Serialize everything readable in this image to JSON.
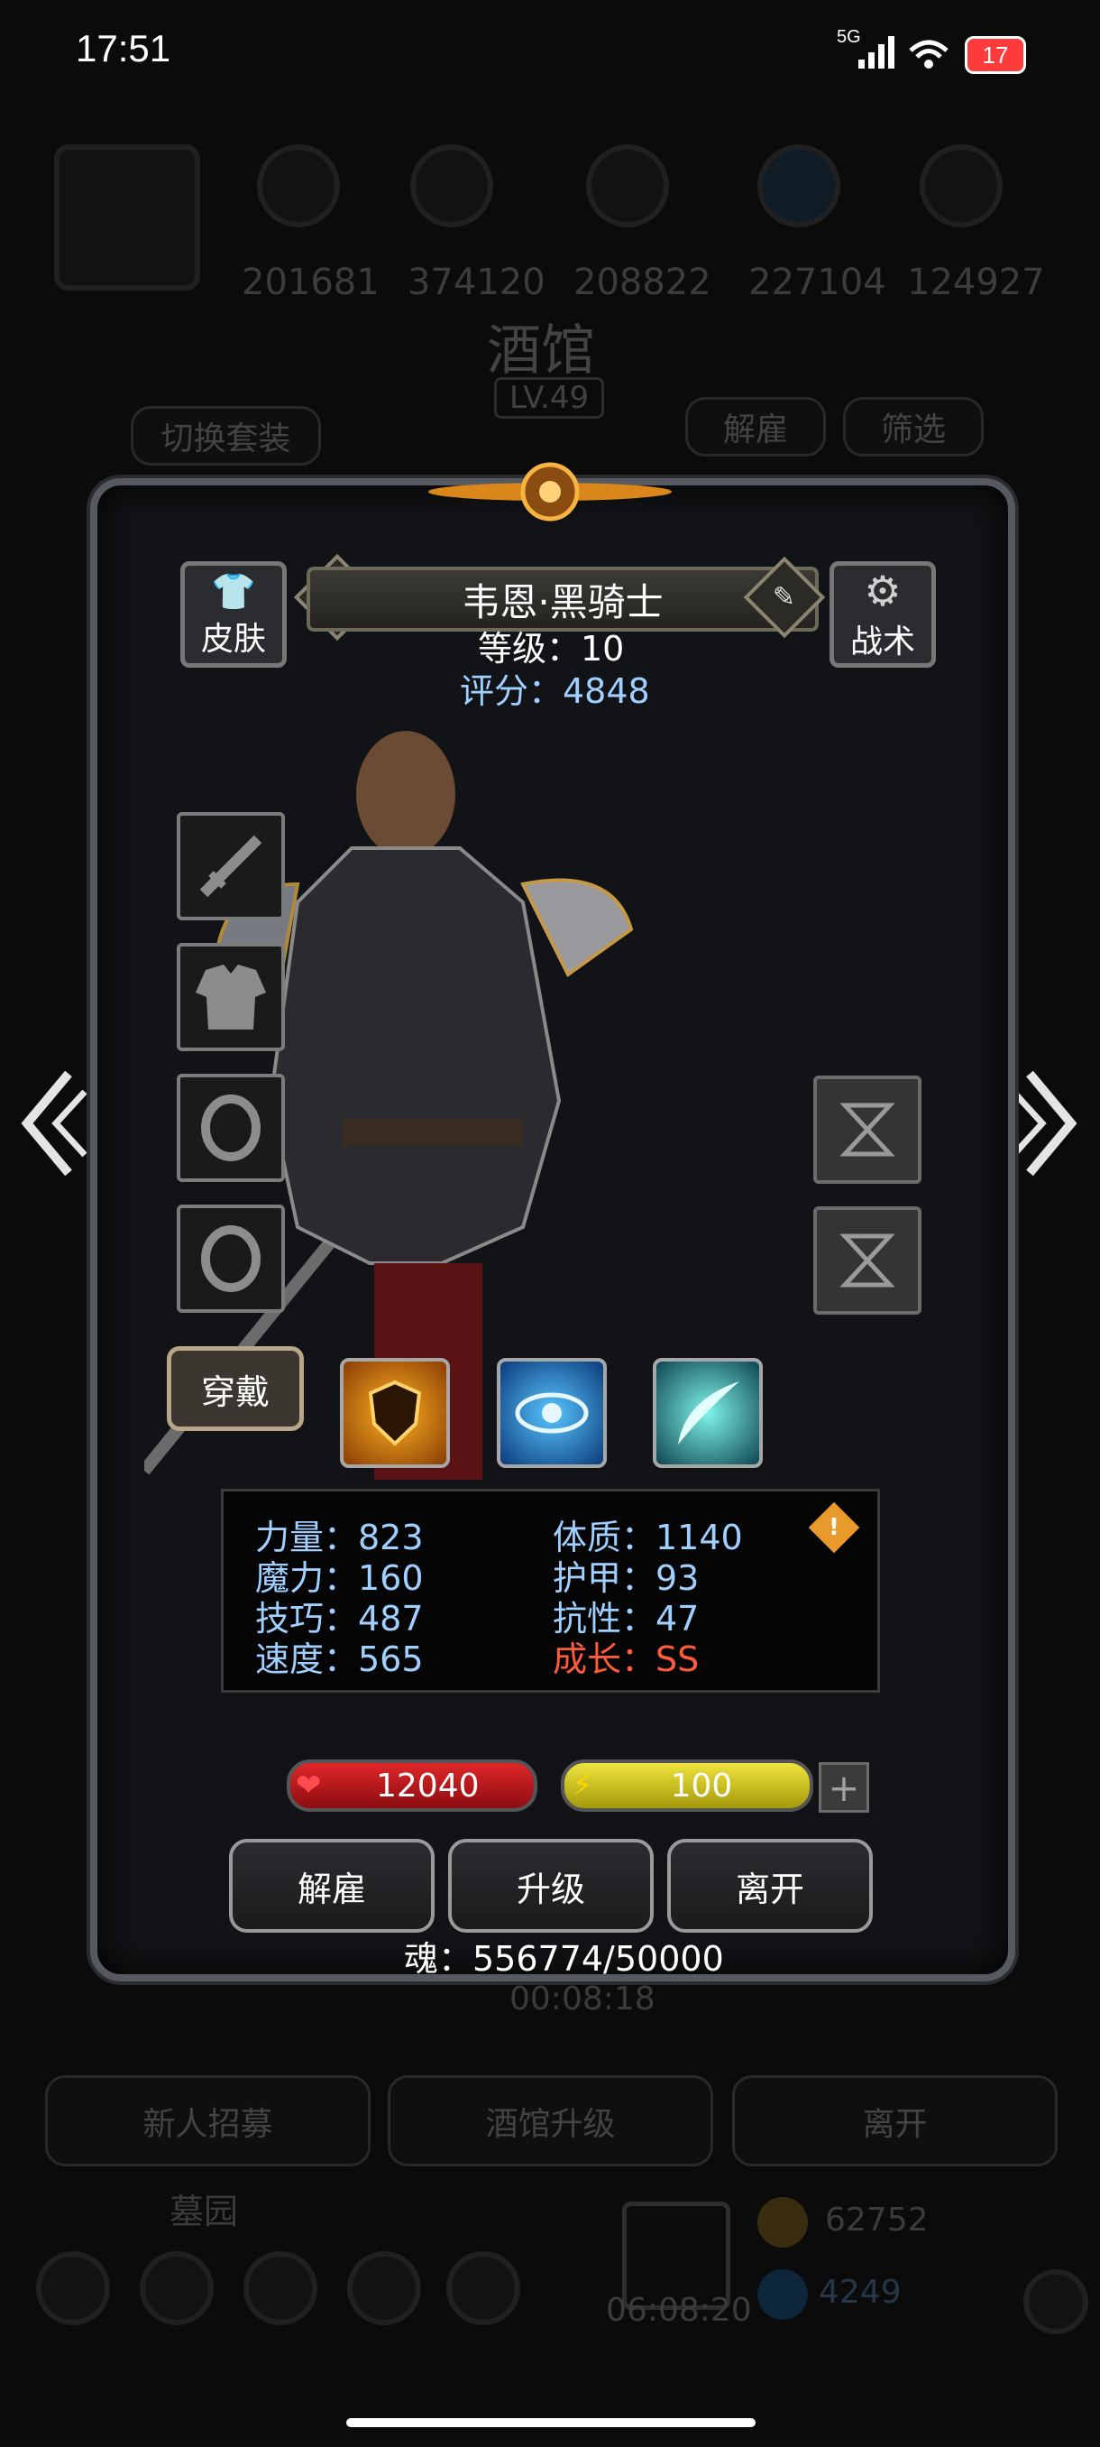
{
  "status_bar": {
    "time": "17:51",
    "network": "5G",
    "battery": "17"
  },
  "background": {
    "numbers": [
      "201681",
      "374120",
      "208822",
      "227104",
      "124927"
    ],
    "title": "酒馆",
    "level": "LV.49",
    "switch_outfit": "切换套装",
    "dismiss": "解雇",
    "filter": "筛选",
    "timer": "00:08:18",
    "bottom_buttons": [
      "新人招募",
      "酒馆升级",
      "离开"
    ],
    "mercenary_label": "墓园",
    "bottom_timer": "06:08:20",
    "currency_1": "62752",
    "currency_2": "4249"
  },
  "hero": {
    "skin_label": "皮肤",
    "tactics_label": "战术",
    "name": "韦恩·黑骑士",
    "level_text": "等级：10",
    "score_text": "评分：4848",
    "equip_label": "穿戴"
  },
  "stats": {
    "left": [
      "力量：823",
      "魔力：160",
      "技巧：487",
      "速度：565"
    ],
    "right": [
      "体质：1140",
      "护甲：93",
      "抗性：47"
    ],
    "growth": "成长：SS"
  },
  "bars": {
    "hp": "12040",
    "energy": "100"
  },
  "actions": {
    "dismiss": "解雇",
    "upgrade": "升级",
    "leave": "离开"
  },
  "soul_text": "魂：556774/50000",
  "colors": {
    "accent_blue": "#9fd0ff",
    "growth_red": "#ff5a3a",
    "hp_red": "#c8161a",
    "energy_yellow": "#e2d317"
  }
}
